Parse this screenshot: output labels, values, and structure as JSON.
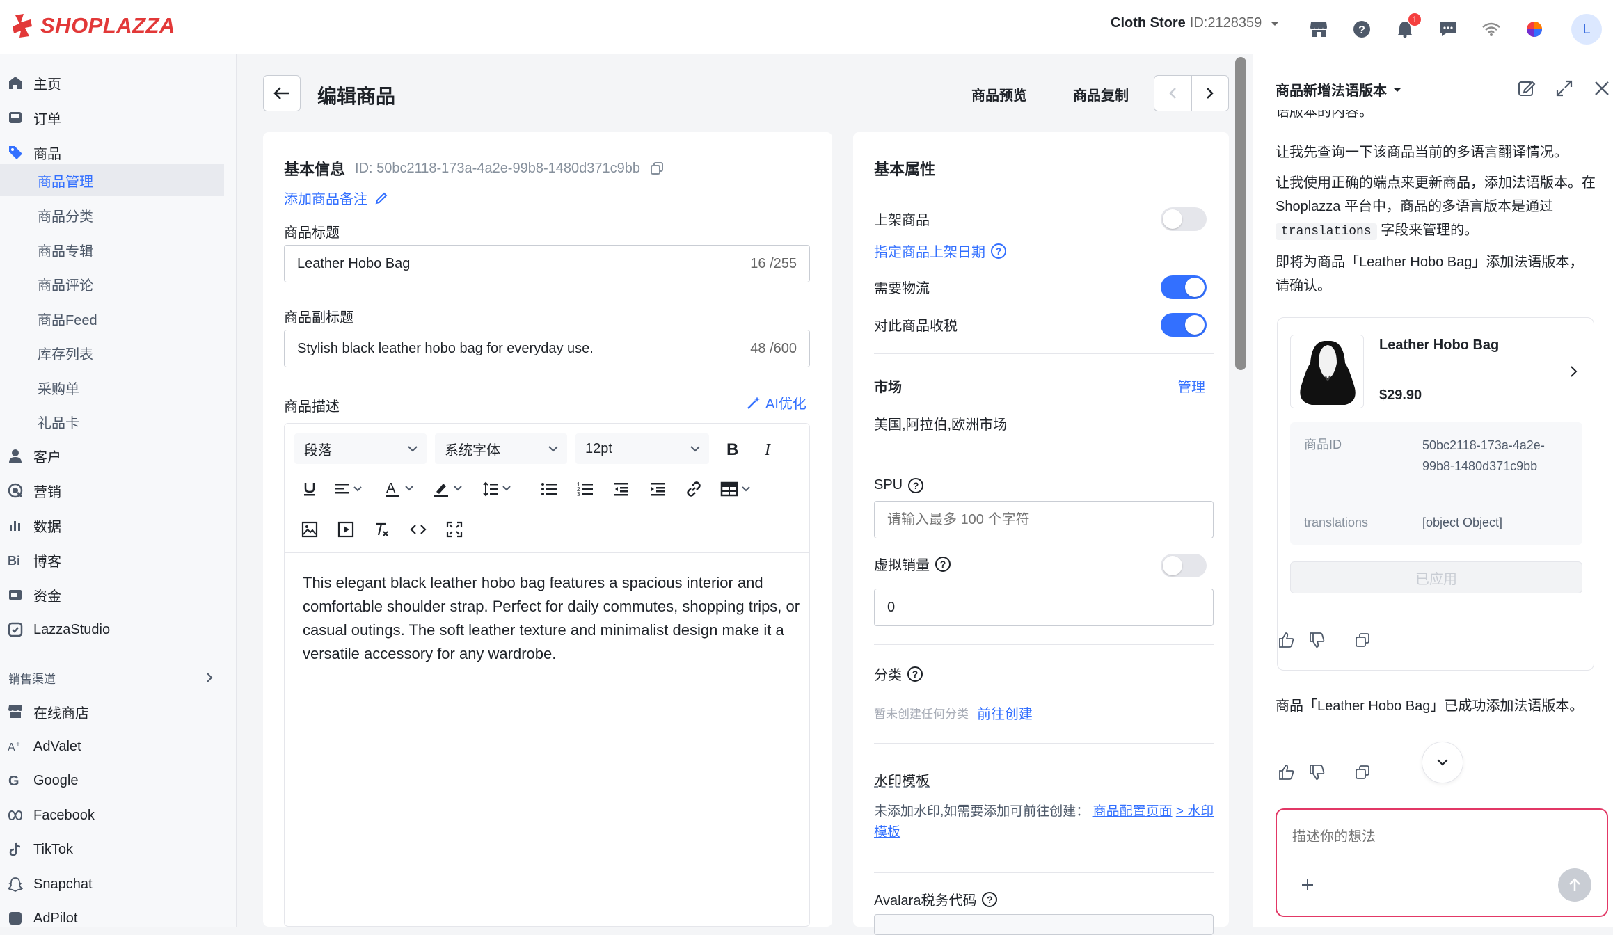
{
  "brand": {
    "name": "SHOPLAZZA",
    "color": "#e23838",
    "accent": "#3370ff"
  },
  "topbar": {
    "store_name": "Cloth Store",
    "store_id": "ID:2128359",
    "notification_count": "1",
    "avatar_letter": "L",
    "icons": [
      "store-icon",
      "help-icon",
      "bell-icon",
      "chat-icon",
      "wifi-icon",
      "colorwheel-icon"
    ]
  },
  "sidebar": {
    "items": [
      {
        "label": "主页",
        "icon": "home-icon"
      },
      {
        "label": "订单",
        "icon": "inbox-icon"
      },
      {
        "label": "商品",
        "icon": "tag-icon"
      },
      {
        "label": "客户",
        "icon": "person-icon"
      },
      {
        "label": "营销",
        "icon": "marketing-icon"
      },
      {
        "label": "数据",
        "icon": "bar-chart-icon"
      },
      {
        "label": "博客",
        "icon": "blog-icon"
      },
      {
        "label": "资金",
        "icon": "wallet-icon"
      },
      {
        "label": "LazzaStudio",
        "icon": "studio-icon"
      }
    ],
    "product_sub": [
      "商品管理",
      "商品分类",
      "商品专辑",
      "商品评论",
      "商品Feed",
      "库存列表",
      "采购单",
      "礼品卡"
    ],
    "sales_channel_title": "销售渠道",
    "channels": [
      {
        "label": "在线商店",
        "icon": "store-icon"
      },
      {
        "label": "AdValet",
        "icon": "advalet-icon"
      },
      {
        "label": "Google",
        "icon": "google-icon"
      },
      {
        "label": "Facebook",
        "icon": "facebook-icon"
      },
      {
        "label": "TikTok",
        "icon": "tiktok-icon"
      },
      {
        "label": "Snapchat",
        "icon": "snapchat-icon"
      },
      {
        "label": "AdPilot",
        "icon": "adpilot-icon"
      }
    ]
  },
  "page": {
    "title": "编辑商品",
    "preview": "商品预览",
    "copy": "商品复制"
  },
  "basic": {
    "title": "基本信息",
    "id": "ID: 50bc2118-173a-4a2e-99b8-1480d371c9bb",
    "add_note": "添加商品备注",
    "title_label": "商品标题",
    "title_value": "Leather Hobo Bag",
    "title_count": "16 /255",
    "subtitle_label": "商品副标题",
    "subtitle_value": "Stylish black leather hobo bag for everyday use.",
    "subtitle_count": "48 /600",
    "desc_label": "商品描述",
    "ai_optimize": "AI优化"
  },
  "editor": {
    "paragraph": "段落",
    "font": "系统字体",
    "size": "12pt",
    "body": "This elegant black leather hobo bag features a spacious interior and comfortable shoulder strap. Perfect for daily commutes, shopping trips, or casual outings. The soft leather texture and minimalist design make it a versatile accessory for any wardrobe."
  },
  "attrs": {
    "title": "基本属性",
    "on_shelf": "上架商品",
    "on_shelf_on": false,
    "schedule": "指定商品上架日期",
    "shipping": "需要物流",
    "shipping_on": true,
    "tax": "对此商品收税",
    "tax_on": true,
    "market_title": "市场",
    "market_manage": "管理",
    "market_value": "美国,阿拉伯,欧洲市场",
    "spu_label": "SPU",
    "spu_placeholder": "请输入最多 100 个字符",
    "virtual_sales": "虚拟销量",
    "virtual_on": false,
    "virtual_value": "0",
    "category_label": "分类",
    "category_empty": "暂未创建任何分类",
    "category_create": "前往创建",
    "watermark_label": "水印模板",
    "watermark_text": "未添加水印,如需要添加可前往创建：",
    "watermark_link1": "商品配置页面",
    "watermark_link2": "> 水印模板",
    "avalara_label": "Avalara税务代码"
  },
  "panel": {
    "title": "商品新增法语版本",
    "clipped_top": "语版本的内容。",
    "msg1": "让我先查询一下该商品当前的多语言翻译情况。",
    "msg2a": "让我使用正确的端点来更新商品，添加法语版本。在 Shoplazza 平台中，商品的多语言版本是通过",
    "msg2_code": "translations",
    "msg2b": "字段来管理的。",
    "msg3": "即将为商品「Leather Hobo Bag」添加法语版本，请确认。",
    "product_name": "Leather Hobo Bag",
    "product_price": "$29.90",
    "kv": [
      {
        "k": "商品ID",
        "v": "50bc2118-173a-4a2e-99b8-1480d371c9bb"
      },
      {
        "k": "translations",
        "v": "[object Object]"
      }
    ],
    "applied": "已应用",
    "msg4": "商品「Leather Hobo Bag」已成功添加法语版本。",
    "input_placeholder": "描述你的想法"
  }
}
